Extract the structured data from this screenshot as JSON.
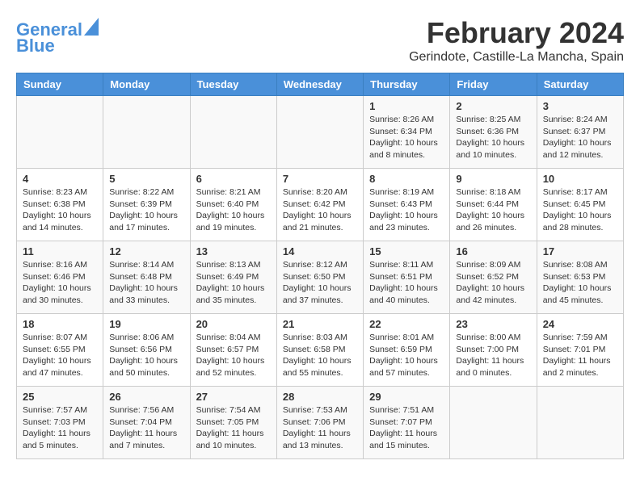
{
  "header": {
    "logo_line1": "General",
    "logo_line2": "Blue",
    "title": "February 2024",
    "subtitle": "Gerindote, Castille-La Mancha, Spain"
  },
  "days_of_week": [
    "Sunday",
    "Monday",
    "Tuesday",
    "Wednesday",
    "Thursday",
    "Friday",
    "Saturday"
  ],
  "weeks": [
    [
      {
        "day": "",
        "detail": ""
      },
      {
        "day": "",
        "detail": ""
      },
      {
        "day": "",
        "detail": ""
      },
      {
        "day": "",
        "detail": ""
      },
      {
        "day": "1",
        "detail": "Sunrise: 8:26 AM\nSunset: 6:34 PM\nDaylight: 10 hours\nand 8 minutes."
      },
      {
        "day": "2",
        "detail": "Sunrise: 8:25 AM\nSunset: 6:36 PM\nDaylight: 10 hours\nand 10 minutes."
      },
      {
        "day": "3",
        "detail": "Sunrise: 8:24 AM\nSunset: 6:37 PM\nDaylight: 10 hours\nand 12 minutes."
      }
    ],
    [
      {
        "day": "4",
        "detail": "Sunrise: 8:23 AM\nSunset: 6:38 PM\nDaylight: 10 hours\nand 14 minutes."
      },
      {
        "day": "5",
        "detail": "Sunrise: 8:22 AM\nSunset: 6:39 PM\nDaylight: 10 hours\nand 17 minutes."
      },
      {
        "day": "6",
        "detail": "Sunrise: 8:21 AM\nSunset: 6:40 PM\nDaylight: 10 hours\nand 19 minutes."
      },
      {
        "day": "7",
        "detail": "Sunrise: 8:20 AM\nSunset: 6:42 PM\nDaylight: 10 hours\nand 21 minutes."
      },
      {
        "day": "8",
        "detail": "Sunrise: 8:19 AM\nSunset: 6:43 PM\nDaylight: 10 hours\nand 23 minutes."
      },
      {
        "day": "9",
        "detail": "Sunrise: 8:18 AM\nSunset: 6:44 PM\nDaylight: 10 hours\nand 26 minutes."
      },
      {
        "day": "10",
        "detail": "Sunrise: 8:17 AM\nSunset: 6:45 PM\nDaylight: 10 hours\nand 28 minutes."
      }
    ],
    [
      {
        "day": "11",
        "detail": "Sunrise: 8:16 AM\nSunset: 6:46 PM\nDaylight: 10 hours\nand 30 minutes."
      },
      {
        "day": "12",
        "detail": "Sunrise: 8:14 AM\nSunset: 6:48 PM\nDaylight: 10 hours\nand 33 minutes."
      },
      {
        "day": "13",
        "detail": "Sunrise: 8:13 AM\nSunset: 6:49 PM\nDaylight: 10 hours\nand 35 minutes."
      },
      {
        "day": "14",
        "detail": "Sunrise: 8:12 AM\nSunset: 6:50 PM\nDaylight: 10 hours\nand 37 minutes."
      },
      {
        "day": "15",
        "detail": "Sunrise: 8:11 AM\nSunset: 6:51 PM\nDaylight: 10 hours\nand 40 minutes."
      },
      {
        "day": "16",
        "detail": "Sunrise: 8:09 AM\nSunset: 6:52 PM\nDaylight: 10 hours\nand 42 minutes."
      },
      {
        "day": "17",
        "detail": "Sunrise: 8:08 AM\nSunset: 6:53 PM\nDaylight: 10 hours\nand 45 minutes."
      }
    ],
    [
      {
        "day": "18",
        "detail": "Sunrise: 8:07 AM\nSunset: 6:55 PM\nDaylight: 10 hours\nand 47 minutes."
      },
      {
        "day": "19",
        "detail": "Sunrise: 8:06 AM\nSunset: 6:56 PM\nDaylight: 10 hours\nand 50 minutes."
      },
      {
        "day": "20",
        "detail": "Sunrise: 8:04 AM\nSunset: 6:57 PM\nDaylight: 10 hours\nand 52 minutes."
      },
      {
        "day": "21",
        "detail": "Sunrise: 8:03 AM\nSunset: 6:58 PM\nDaylight: 10 hours\nand 55 minutes."
      },
      {
        "day": "22",
        "detail": "Sunrise: 8:01 AM\nSunset: 6:59 PM\nDaylight: 10 hours\nand 57 minutes."
      },
      {
        "day": "23",
        "detail": "Sunrise: 8:00 AM\nSunset: 7:00 PM\nDaylight: 11 hours\nand 0 minutes."
      },
      {
        "day": "24",
        "detail": "Sunrise: 7:59 AM\nSunset: 7:01 PM\nDaylight: 11 hours\nand 2 minutes."
      }
    ],
    [
      {
        "day": "25",
        "detail": "Sunrise: 7:57 AM\nSunset: 7:03 PM\nDaylight: 11 hours\nand 5 minutes."
      },
      {
        "day": "26",
        "detail": "Sunrise: 7:56 AM\nSunset: 7:04 PM\nDaylight: 11 hours\nand 7 minutes."
      },
      {
        "day": "27",
        "detail": "Sunrise: 7:54 AM\nSunset: 7:05 PM\nDaylight: 11 hours\nand 10 minutes."
      },
      {
        "day": "28",
        "detail": "Sunrise: 7:53 AM\nSunset: 7:06 PM\nDaylight: 11 hours\nand 13 minutes."
      },
      {
        "day": "29",
        "detail": "Sunrise: 7:51 AM\nSunset: 7:07 PM\nDaylight: 11 hours\nand 15 minutes."
      },
      {
        "day": "",
        "detail": ""
      },
      {
        "day": "",
        "detail": ""
      }
    ]
  ]
}
